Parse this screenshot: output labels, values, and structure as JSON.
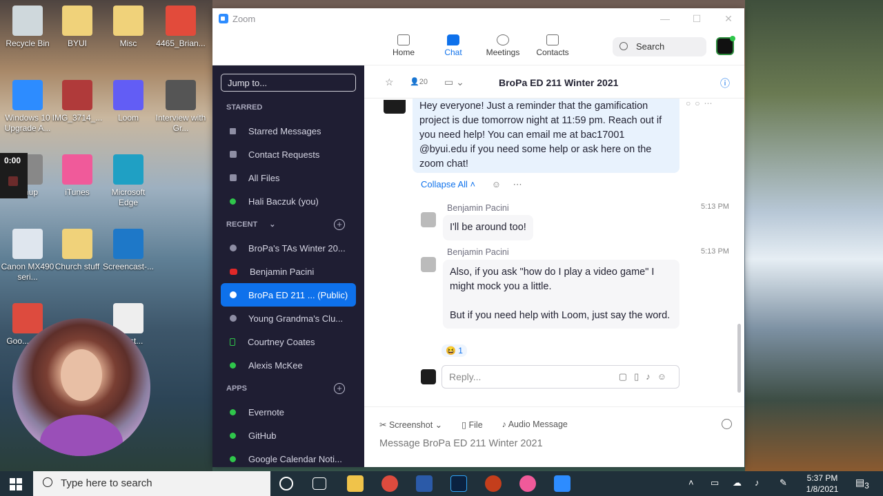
{
  "desktop": {
    "icons": [
      {
        "label": "Recycle Bin",
        "color": "#cfd8dc"
      },
      {
        "label": "BYUI",
        "color": "#f0d27a"
      },
      {
        "label": "Misc",
        "color": "#f0d27a"
      },
      {
        "label": "4465_Brian...",
        "color": "#e24b3b"
      },
      {
        "label": "Windows 10 Upgrade A...",
        "color": "#2d8cff"
      },
      {
        "label": "IMG_3714_...",
        "color": "#b03a3a"
      },
      {
        "label": "Loom",
        "color": "#625df5"
      },
      {
        "label": "Interview with Gr...",
        "color": "#555555"
      },
      {
        "label": "...hup",
        "color": "#888888"
      },
      {
        "label": "iTunes",
        "color": "#f05a9a"
      },
      {
        "label": "Microsoft Edge",
        "color": "#1fa0c4"
      },
      {
        "label": "Canon MX490 seri...",
        "color": "#dfe6ee"
      },
      {
        "label": "Church stuff",
        "color": "#f0d27a"
      },
      {
        "label": "Screencast-...",
        "color": "#1e78c8"
      },
      {
        "label": "Goo... Ch...",
        "color": "#dd4b3e"
      },
      {
        "label": "...hrist...",
        "color": "#eeeeee"
      }
    ],
    "timer": "0:00"
  },
  "zoom": {
    "title": "Zoom",
    "nav": {
      "home": "Home",
      "chat": "Chat",
      "meetings": "Meetings",
      "contacts": "Contacts"
    },
    "search_placeholder": "Search",
    "sidebar": {
      "jump_placeholder": "Jump to...",
      "starred_header": "STARRED",
      "starred": [
        "Starred Messages",
        "Contact Requests",
        "All Files",
        "Hali Baczuk (you)"
      ],
      "recent_header": "RECENT",
      "recent": [
        "BroPa's TAs Winter 20...",
        "Benjamin Pacini",
        "BroPa ED 211 ... (Public)",
        "Young Grandma's Clu...",
        "Courtney Coates",
        "Alexis McKee"
      ],
      "apps_header": "APPS",
      "apps": [
        "Evernote",
        "GitHub",
        "Google Calendar Noti..."
      ]
    },
    "chat": {
      "title": "BroPa ED 211 Winter 2021",
      "member_count": "20",
      "main_message": "Hey everyone! Just a reminder that the gamification project is due tomorrow night at 11:59 pm. Reach out if you need help! You can email me at bac17001 @byui.edu if you need some help or ask here on the zoom chat!",
      "collapse_label": "Collapse All",
      "replies": [
        {
          "name": "Benjamin Pacini",
          "time": "5:13 PM",
          "text": "I'll be around too!"
        },
        {
          "name": "Benjamin Pacini",
          "time": "5:13 PM",
          "text_1": "Also, if you ask \"how do I play a video game\" I might mock you a little.",
          "text_2": "But if you need help with Loom, just say the word."
        }
      ],
      "reaction": "😆 1",
      "reply_placeholder": "Reply...",
      "tools": {
        "screenshot": "Screenshot",
        "file": "File",
        "audio": "Audio Message"
      },
      "composer_placeholder": "Message BroPa ED 211 Winter 2021"
    }
  },
  "taskbar": {
    "search_placeholder": "Type here to search",
    "time": "5:37 PM",
    "date": "1/8/2021",
    "notif_count": "3"
  }
}
